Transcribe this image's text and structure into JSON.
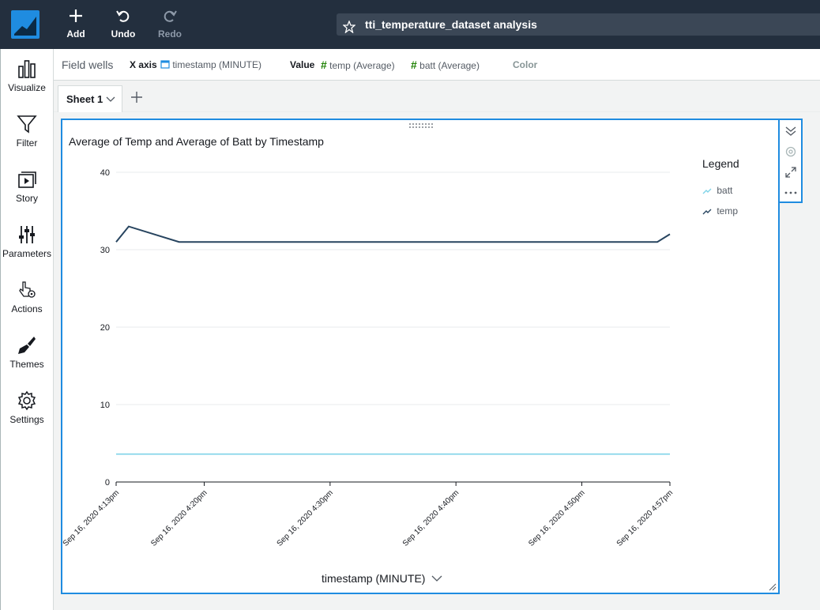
{
  "toolbar": {
    "add_label": "Add",
    "undo_label": "Undo",
    "redo_label": "Redo",
    "analysis_title": "tti_temperature_dataset analysis"
  },
  "sidebar": {
    "items": [
      {
        "label": "Visualize",
        "icon": "bar-chart-icon"
      },
      {
        "label": "Filter",
        "icon": "filter-icon"
      },
      {
        "label": "Story",
        "icon": "story-icon"
      },
      {
        "label": "Parameters",
        "icon": "sliders-icon"
      },
      {
        "label": "Actions",
        "icon": "pointer-gear-icon"
      },
      {
        "label": "Themes",
        "icon": "brush-icon"
      },
      {
        "label": "Settings",
        "icon": "gear-icon"
      }
    ]
  },
  "field_wells": {
    "label": "Field wells",
    "x_axis_key": "X axis",
    "x_axis_value": "timestamp (MINUTE)",
    "value_key": "Value",
    "value_1": "temp (Average)",
    "value_2": "batt (Average)",
    "color_key": "Color"
  },
  "sheets": {
    "active": "Sheet 1"
  },
  "visual": {
    "x_field_label": "timestamp (MINUTE)"
  },
  "colors": {
    "accent": "#1f8ce0",
    "topbar": "#232f3e",
    "temp_series": "#27445f",
    "batt_series": "#7fd3e8",
    "field_icon_green": "#1d8102"
  },
  "chart_data": {
    "type": "line",
    "title": "Average of Temp and Average of Batt by Timestamp",
    "xlabel": "timestamp (MINUTE)",
    "ylabel": "",
    "ylim": [
      0,
      40
    ],
    "yticks": [
      0,
      10,
      20,
      30,
      40
    ],
    "xlim": [
      "Sep 16, 2020 4:13pm",
      "Sep 16, 2020 4:57pm"
    ],
    "xticks": [
      "Sep 16, 2020 4:13pm",
      "Sep 16, 2020 4:20pm",
      "Sep 16, 2020 4:30pm",
      "Sep 16, 2020 4:40pm",
      "Sep 16, 2020 4:50pm",
      "Sep 16, 2020 4:57pm"
    ],
    "grid": true,
    "legend": {
      "title": "Legend",
      "position": "right"
    },
    "series": [
      {
        "name": "batt",
        "x": [
          "Sep 16, 2020 4:13pm",
          "Sep 16, 2020 4:57pm"
        ],
        "values": [
          3.6,
          3.6
        ]
      },
      {
        "name": "temp",
        "x": [
          "Sep 16, 2020 4:13pm",
          "Sep 16, 2020 4:14pm",
          "Sep 16, 2020 4:18pm",
          "Sep 16, 2020 4:56pm",
          "Sep 16, 2020 4:57pm"
        ],
        "values": [
          31,
          33,
          31,
          31,
          32
        ]
      }
    ]
  }
}
